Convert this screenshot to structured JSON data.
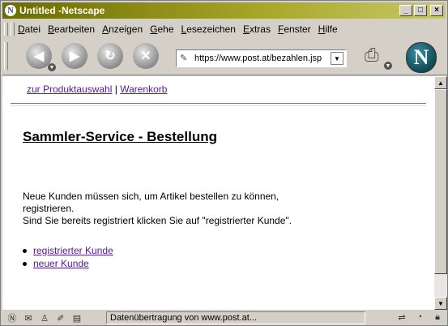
{
  "window": {
    "title": "Untitled -Netscape"
  },
  "menu": [
    "Datei",
    "Bearbeiten",
    "Anzeigen",
    "Gehe",
    "Lesezeichen",
    "Extras",
    "Fenster",
    "Hilfe"
  ],
  "menu_underline": [
    "D",
    "B",
    "A",
    "G",
    "L",
    "E",
    "F",
    "H"
  ],
  "address": {
    "url": "https://www.post.at/bezahlen.jsp"
  },
  "page": {
    "nav_link_1": "zur Produktauswahl",
    "nav_sep": "|",
    "nav_link_2": "Warenkorb",
    "heading": "Sammler-Service - Bestellung",
    "para_line1": "Neue Kunden müssen sich, um Artikel bestellen zu können,",
    "para_line2": "registrieren.",
    "para_line3": "Sind Sie bereits registriert klicken Sie auf \"registrierter Kunde\".",
    "option_1": "registrierter Kunde",
    "option_2": "neuer Kunde"
  },
  "status": {
    "text": "Datenübertragung von www.post.at..."
  },
  "colors": {
    "title_bar": "#8a8a1a",
    "link_visited": "#551a8b",
    "chrome": "#d4d0c8"
  }
}
